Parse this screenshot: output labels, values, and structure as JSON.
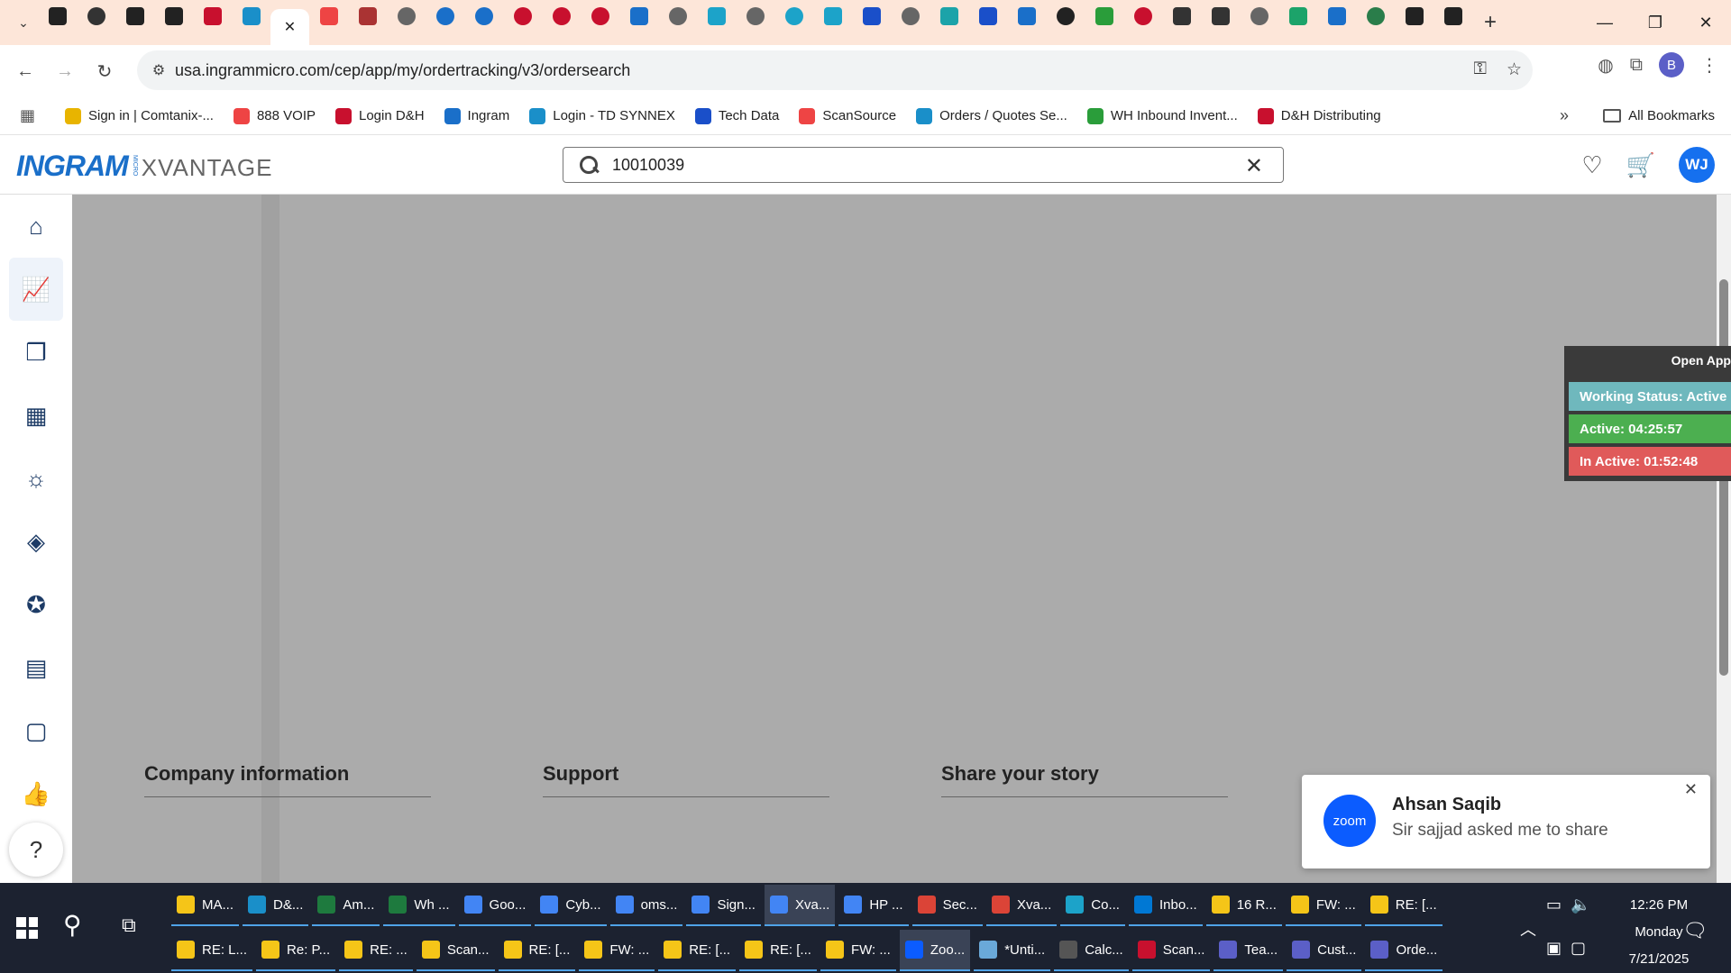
{
  "browser": {
    "url": "usa.ingrammicro.com/cep/app/my/ordertracking/v3/ordersearch",
    "profile_initial": "B",
    "tabs": [
      {
        "icon": "amazon",
        "color": "#222"
      },
      {
        "icon": "amazon-circle",
        "color": "#333"
      },
      {
        "icon": "amazon",
        "color": "#222"
      },
      {
        "icon": "amazon",
        "color": "#222"
      },
      {
        "icon": "dh",
        "color": "#c8102e"
      },
      {
        "icon": "ec",
        "color": "#1a8fc9"
      },
      {
        "icon": "close",
        "color": "#222",
        "active": true
      },
      {
        "icon": "scansource",
        "color": "#e44"
      },
      {
        "icon": "synnex",
        "color": "#a33"
      },
      {
        "icon": "globe",
        "color": "#666"
      },
      {
        "icon": "att",
        "color": "#1a6fc9"
      },
      {
        "icon": "edge-like",
        "color": "#1a6fc9"
      },
      {
        "icon": "lg",
        "color": "#c8102e"
      },
      {
        "icon": "lg",
        "color": "#c8102e"
      },
      {
        "icon": "lg",
        "color": "#c8102e"
      },
      {
        "icon": "hp",
        "color": "#1a6fc9"
      },
      {
        "icon": "globe",
        "color": "#666"
      },
      {
        "icon": "pl",
        "color": "#1ca3c9"
      },
      {
        "icon": "globe",
        "color": "#666"
      },
      {
        "icon": "ring",
        "color": "#1ca3c9"
      },
      {
        "icon": "pl",
        "color": "#1ca3c9"
      },
      {
        "icon": "arrow",
        "color": "#1a4fc9"
      },
      {
        "icon": "globe",
        "color": "#666"
      },
      {
        "icon": "leaf",
        "color": "#1ca3a9"
      },
      {
        "icon": "u",
        "color": "#1a4fc9"
      },
      {
        "icon": "cloud",
        "color": "#1a6fc9"
      },
      {
        "icon": "openai",
        "color": "#222"
      },
      {
        "icon": "plus-green",
        "color": "#2a9d3a"
      },
      {
        "icon": "red-circle",
        "color": "#c8102e"
      },
      {
        "icon": "stripe",
        "color": "#333"
      },
      {
        "icon": "stripe",
        "color": "#333"
      },
      {
        "icon": "globe",
        "color": "#666"
      },
      {
        "icon": "logi",
        "color": "#1ca36a"
      },
      {
        "icon": "dollar",
        "color": "#1a6fc9"
      },
      {
        "icon": "green-circle",
        "color": "#2a7d4a"
      },
      {
        "icon": "amazon",
        "color": "#222"
      },
      {
        "icon": "amazon",
        "color": "#222"
      }
    ]
  },
  "bookmarks": [
    {
      "label": "Sign in | Comtanix-...",
      "color": "#e8b400"
    },
    {
      "label": "888 VOIP",
      "color": "#e44"
    },
    {
      "label": "Login D&H",
      "color": "#c8102e"
    },
    {
      "label": "Ingram",
      "color": "#1a6fc9"
    },
    {
      "label": "Login - TD SYNNEX",
      "color": "#1a8fc9"
    },
    {
      "label": "Tech Data",
      "color": "#1a4fc9"
    },
    {
      "label": "ScanSource",
      "color": "#e44"
    },
    {
      "label": "Orders / Quotes Se...",
      "color": "#1a8fc9"
    },
    {
      "label": "WH Inbound Invent...",
      "color": "#2a9d3a"
    },
    {
      "label": "D&H Distributing",
      "color": "#c8102e"
    }
  ],
  "all_bookmarks_label": "All Bookmarks",
  "app": {
    "logo_main": "INGRAM",
    "logo_micro": "MICRO",
    "logo_sub": "XVANTAGE",
    "search_value": "10010039",
    "avatar_initials": "WJ",
    "accent_color": "#1570ef"
  },
  "sidebar": {
    "items": [
      {
        "name": "home",
        "glyph": "⌂"
      },
      {
        "name": "analytics",
        "glyph": "📈",
        "active": true
      },
      {
        "name": "box",
        "glyph": "❒"
      },
      {
        "name": "warehouse",
        "glyph": "▦"
      },
      {
        "name": "lightbulb",
        "glyph": "☼"
      },
      {
        "name": "stack",
        "glyph": "◈"
      },
      {
        "name": "badge",
        "glyph": "✪"
      },
      {
        "name": "calendar",
        "glyph": "▤"
      },
      {
        "name": "bag",
        "glyph": "▢"
      },
      {
        "name": "thumbs-up",
        "glyph": "👍"
      }
    ],
    "help_glyph": "?"
  },
  "footer": {
    "columns": [
      "Company information",
      "Support",
      "Share your story"
    ]
  },
  "widget": {
    "open_label": "Open App",
    "working_status": "Working Status: Active",
    "active_time": "Active: 04:25:57",
    "inactive_time": "In Active: 01:52:48",
    "colors": {
      "working": "#6fb8bd",
      "active": "#4caf50",
      "inactive": "#e05a5a"
    }
  },
  "toast": {
    "logo_text": "zoom",
    "name": "Ahsan Saqib",
    "message": "Sir sajjad asked me to share"
  },
  "taskbar": {
    "row1": [
      {
        "label": "MA...",
        "color": "#f5c518"
      },
      {
        "label": "D&...",
        "color": "#1a8fc9"
      },
      {
        "label": "Am...",
        "color": "#1e7a3e"
      },
      {
        "label": "Wh ...",
        "color": "#1e7a3e"
      },
      {
        "label": "Goo...",
        "color": "#4285f4"
      },
      {
        "label": "Cyb...",
        "color": "#4285f4"
      },
      {
        "label": "oms...",
        "color": "#4285f4"
      },
      {
        "label": "Sign...",
        "color": "#4285f4"
      },
      {
        "label": "Xva...",
        "color": "#4285f4",
        "highlight": true
      },
      {
        "label": "HP ...",
        "color": "#4285f4"
      },
      {
        "label": "Sec...",
        "color": "#db4437"
      },
      {
        "label": "Xva...",
        "color": "#db4437"
      },
      {
        "label": "Co...",
        "color": "#1ca3c9"
      },
      {
        "label": "Inbo...",
        "color": "#0078d4"
      },
      {
        "label": "16 R...",
        "color": "#f5c518"
      },
      {
        "label": "FW: ...",
        "color": "#f5c518"
      },
      {
        "label": "RE: [...",
        "color": "#f5c518"
      }
    ],
    "row2": [
      {
        "label": "RE: L...",
        "color": "#f5c518"
      },
      {
        "label": "Re: P...",
        "color": "#f5c518"
      },
      {
        "label": "RE: ...",
        "color": "#f5c518"
      },
      {
        "label": "Scan...",
        "color": "#f5c518"
      },
      {
        "label": "RE: [...",
        "color": "#f5c518"
      },
      {
        "label": "FW: ...",
        "color": "#f5c518"
      },
      {
        "label": "RE: [...",
        "color": "#f5c518"
      },
      {
        "label": "RE: [...",
        "color": "#f5c518"
      },
      {
        "label": "FW: ...",
        "color": "#f5c518"
      },
      {
        "label": "Zoo...",
        "color": "#0b5cff",
        "highlight": true
      },
      {
        "label": "*Unti...",
        "color": "#6aa9d9"
      },
      {
        "label": "Calc...",
        "color": "#555"
      },
      {
        "label": "Scan...",
        "color": "#c8102e"
      },
      {
        "label": "Tea...",
        "color": "#5b5fc7"
      },
      {
        "label": "Cust...",
        "color": "#5b5fc7"
      },
      {
        "label": "Orde...",
        "color": "#5b5fc7"
      }
    ],
    "time": "12:26 PM",
    "day": "Monday",
    "date": "7/21/2025"
  }
}
